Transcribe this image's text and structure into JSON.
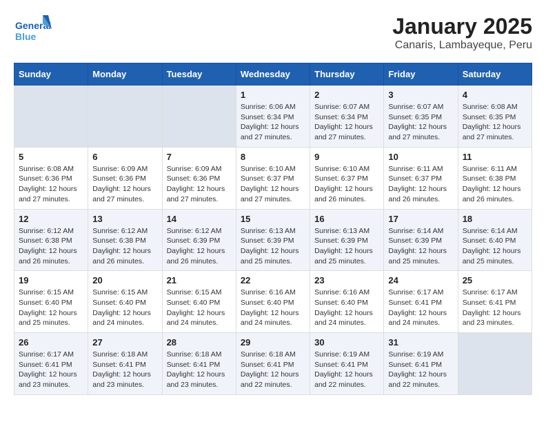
{
  "header": {
    "logo_line1": "General",
    "logo_line2": "Blue",
    "title": "January 2025",
    "subtitle": "Canaris, Lambayeque, Peru"
  },
  "weekdays": [
    "Sunday",
    "Monday",
    "Tuesday",
    "Wednesday",
    "Thursday",
    "Friday",
    "Saturday"
  ],
  "weeks": [
    [
      {
        "day": "",
        "info": ""
      },
      {
        "day": "",
        "info": ""
      },
      {
        "day": "",
        "info": ""
      },
      {
        "day": "1",
        "info": "Sunrise: 6:06 AM\nSunset: 6:34 PM\nDaylight: 12 hours\nand 27 minutes."
      },
      {
        "day": "2",
        "info": "Sunrise: 6:07 AM\nSunset: 6:34 PM\nDaylight: 12 hours\nand 27 minutes."
      },
      {
        "day": "3",
        "info": "Sunrise: 6:07 AM\nSunset: 6:35 PM\nDaylight: 12 hours\nand 27 minutes."
      },
      {
        "day": "4",
        "info": "Sunrise: 6:08 AM\nSunset: 6:35 PM\nDaylight: 12 hours\nand 27 minutes."
      }
    ],
    [
      {
        "day": "5",
        "info": "Sunrise: 6:08 AM\nSunset: 6:36 PM\nDaylight: 12 hours\nand 27 minutes."
      },
      {
        "day": "6",
        "info": "Sunrise: 6:09 AM\nSunset: 6:36 PM\nDaylight: 12 hours\nand 27 minutes."
      },
      {
        "day": "7",
        "info": "Sunrise: 6:09 AM\nSunset: 6:36 PM\nDaylight: 12 hours\nand 27 minutes."
      },
      {
        "day": "8",
        "info": "Sunrise: 6:10 AM\nSunset: 6:37 PM\nDaylight: 12 hours\nand 27 minutes."
      },
      {
        "day": "9",
        "info": "Sunrise: 6:10 AM\nSunset: 6:37 PM\nDaylight: 12 hours\nand 26 minutes."
      },
      {
        "day": "10",
        "info": "Sunrise: 6:11 AM\nSunset: 6:37 PM\nDaylight: 12 hours\nand 26 minutes."
      },
      {
        "day": "11",
        "info": "Sunrise: 6:11 AM\nSunset: 6:38 PM\nDaylight: 12 hours\nand 26 minutes."
      }
    ],
    [
      {
        "day": "12",
        "info": "Sunrise: 6:12 AM\nSunset: 6:38 PM\nDaylight: 12 hours\nand 26 minutes."
      },
      {
        "day": "13",
        "info": "Sunrise: 6:12 AM\nSunset: 6:38 PM\nDaylight: 12 hours\nand 26 minutes."
      },
      {
        "day": "14",
        "info": "Sunrise: 6:12 AM\nSunset: 6:39 PM\nDaylight: 12 hours\nand 26 minutes."
      },
      {
        "day": "15",
        "info": "Sunrise: 6:13 AM\nSunset: 6:39 PM\nDaylight: 12 hours\nand 25 minutes."
      },
      {
        "day": "16",
        "info": "Sunrise: 6:13 AM\nSunset: 6:39 PM\nDaylight: 12 hours\nand 25 minutes."
      },
      {
        "day": "17",
        "info": "Sunrise: 6:14 AM\nSunset: 6:39 PM\nDaylight: 12 hours\nand 25 minutes."
      },
      {
        "day": "18",
        "info": "Sunrise: 6:14 AM\nSunset: 6:40 PM\nDaylight: 12 hours\nand 25 minutes."
      }
    ],
    [
      {
        "day": "19",
        "info": "Sunrise: 6:15 AM\nSunset: 6:40 PM\nDaylight: 12 hours\nand 25 minutes."
      },
      {
        "day": "20",
        "info": "Sunrise: 6:15 AM\nSunset: 6:40 PM\nDaylight: 12 hours\nand 24 minutes."
      },
      {
        "day": "21",
        "info": "Sunrise: 6:15 AM\nSunset: 6:40 PM\nDaylight: 12 hours\nand 24 minutes."
      },
      {
        "day": "22",
        "info": "Sunrise: 6:16 AM\nSunset: 6:40 PM\nDaylight: 12 hours\nand 24 minutes."
      },
      {
        "day": "23",
        "info": "Sunrise: 6:16 AM\nSunset: 6:40 PM\nDaylight: 12 hours\nand 24 minutes."
      },
      {
        "day": "24",
        "info": "Sunrise: 6:17 AM\nSunset: 6:41 PM\nDaylight: 12 hours\nand 24 minutes."
      },
      {
        "day": "25",
        "info": "Sunrise: 6:17 AM\nSunset: 6:41 PM\nDaylight: 12 hours\nand 23 minutes."
      }
    ],
    [
      {
        "day": "26",
        "info": "Sunrise: 6:17 AM\nSunset: 6:41 PM\nDaylight: 12 hours\nand 23 minutes."
      },
      {
        "day": "27",
        "info": "Sunrise: 6:18 AM\nSunset: 6:41 PM\nDaylight: 12 hours\nand 23 minutes."
      },
      {
        "day": "28",
        "info": "Sunrise: 6:18 AM\nSunset: 6:41 PM\nDaylight: 12 hours\nand 23 minutes."
      },
      {
        "day": "29",
        "info": "Sunrise: 6:18 AM\nSunset: 6:41 PM\nDaylight: 12 hours\nand 22 minutes."
      },
      {
        "day": "30",
        "info": "Sunrise: 6:19 AM\nSunset: 6:41 PM\nDaylight: 12 hours\nand 22 minutes."
      },
      {
        "day": "31",
        "info": "Sunrise: 6:19 AM\nSunset: 6:41 PM\nDaylight: 12 hours\nand 22 minutes."
      },
      {
        "day": "",
        "info": ""
      }
    ]
  ]
}
